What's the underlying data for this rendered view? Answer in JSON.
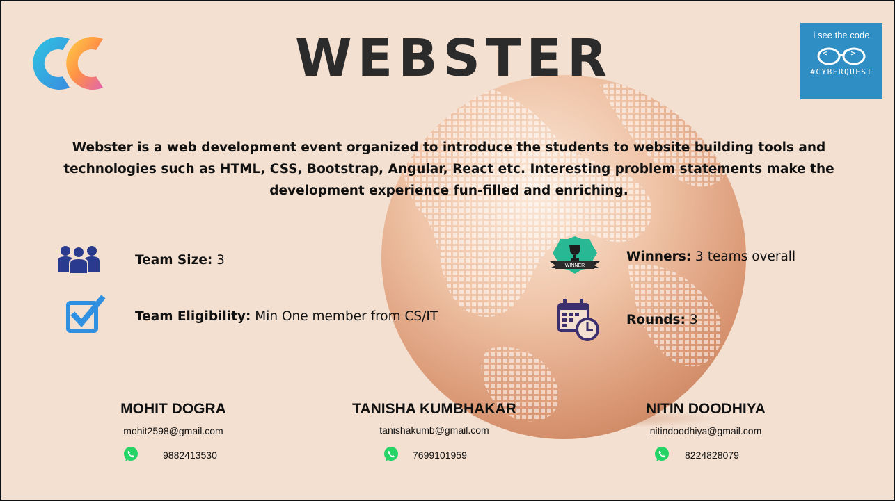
{
  "header": {
    "title": "WEBSTER",
    "badge": {
      "line1": "i see the code",
      "glyphs": "< />",
      "hashtag": "#CYBERQUEST"
    }
  },
  "description": "Webster is a web development event organized to introduce the students to website building tools and technologies such as HTML, CSS, Bootstrap, Angular, React etc. Interesting problem statements make the development experience fun-filled and enriching.",
  "features": {
    "team_size": {
      "label": "Team Size:",
      "value": " 3",
      "icon": "team-icon"
    },
    "eligibility": {
      "label": "Team Eligibility:",
      "value": " Min One member from CS/IT",
      "icon": "checkbox-icon"
    },
    "winners": {
      "label": "Winners:",
      "value": " 3 teams overall",
      "icon": "winner-badge-icon",
      "badge_text": "WINNER"
    },
    "rounds": {
      "label": "Rounds:",
      "value": " 3",
      "icon": "calendar-clock-icon"
    }
  },
  "contacts": [
    {
      "name": "MOHIT DOGRA",
      "email": "mohit2598@gmail.com",
      "phone": "9882413530"
    },
    {
      "name": "TANISHA KUMBHAKAR",
      "email": "tanishakumb@gmail.com",
      "phone": "7699101959"
    },
    {
      "name": "NITIN DOODHIYA",
      "email": "nitindoodhiya@gmail.com",
      "phone": "8224828079"
    }
  ],
  "colors": {
    "background": "#f3e0d1",
    "globe": "#e5a785",
    "badge_bg": "#2f8fc4",
    "whatsapp": "#25d366"
  }
}
